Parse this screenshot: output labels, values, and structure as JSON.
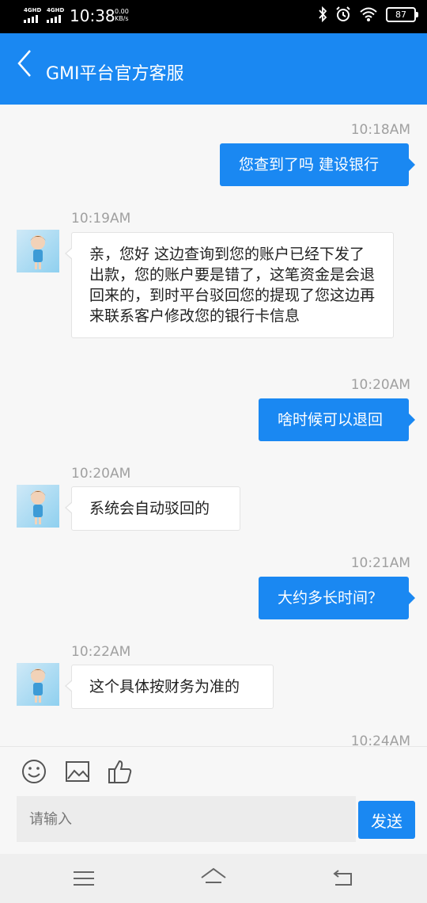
{
  "status_bar": {
    "net1": "4GHD",
    "net2": "4GHD",
    "time": "10:38",
    "speed_value": "0.00",
    "speed_unit": "KB/s",
    "battery": "87",
    "icons": [
      "bluetooth-icon",
      "alarm-icon",
      "wifi-icon",
      "battery-icon"
    ]
  },
  "header": {
    "title": "GMI平台官方客服",
    "back_icon": "chevron-left-icon",
    "color": "#1a88f2"
  },
  "messages": [
    {
      "time": "10:18AM",
      "side": "out",
      "text": "您查到了吗 建设银行"
    },
    {
      "time": "10:19AM",
      "side": "in",
      "text": "亲，您好 这边查询到您的账户已经下发了出款，您的账户要是错了，这笔资金是会退回来的，到时平台驳回您的提现了您这边再来联系客户修改您的银行卡信息"
    },
    {
      "time": "10:20AM",
      "side": "out",
      "text": "啥时候可以退回"
    },
    {
      "time": "10:20AM",
      "side": "in",
      "text": "系统会自动驳回的"
    },
    {
      "time": "10:21AM",
      "side": "out",
      "text": "大约多长时间？"
    },
    {
      "time": "10:22AM",
      "side": "in",
      "text": "这个具体按财务为准的"
    },
    {
      "time": "10:24AM",
      "side": "none",
      "text": ""
    }
  ],
  "toolbar": {
    "icons": [
      "emoji-icon",
      "image-icon",
      "thumbs-up-icon"
    ],
    "input_placeholder": "请输入",
    "input_value": "",
    "send_label": "发送"
  },
  "nav": {
    "icons": [
      "menu-icon",
      "home-icon",
      "back-icon"
    ]
  }
}
